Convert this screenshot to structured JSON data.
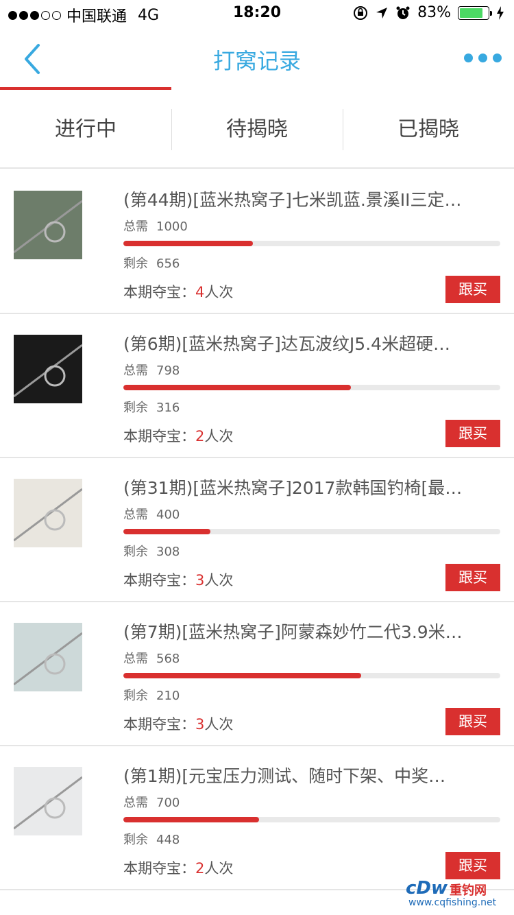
{
  "status_bar": {
    "carrier": "中国联通",
    "network": "4G",
    "time": "18:20",
    "battery": "83%",
    "battery_level": 0.83
  },
  "nav": {
    "title": "打窝记录"
  },
  "tabs": [
    {
      "label": "进行中"
    },
    {
      "label": "待揭晓"
    },
    {
      "label": "已揭晓"
    }
  ],
  "labels": {
    "need": "总需",
    "remain": "剩余",
    "join_prefix": "本期夺宝：",
    "join_suffix": "人次",
    "buy": "跟买"
  },
  "items": [
    {
      "title": "(第44期)[蓝米热窝子]七米凯蓝.景溪II三定…",
      "need": "1000",
      "remain": "656",
      "count": "4",
      "progress": 0.344,
      "thumb_color": "#6d7d6a"
    },
    {
      "title": "(第6期)[蓝米热窝子]达瓦波纹J5.4米超硬…",
      "need": "798",
      "remain": "316",
      "count": "2",
      "progress": 0.604,
      "thumb_color": "#1a1a1a"
    },
    {
      "title": "(第31期)[蓝米热窝子]2017款韩国钓椅[最…",
      "need": "400",
      "remain": "308",
      "count": "3",
      "progress": 0.23,
      "thumb_color": "#e9e6df"
    },
    {
      "title": "(第7期)[蓝米热窝子]阿蒙森妙竹二代3.9米…",
      "need": "568",
      "remain": "210",
      "count": "3",
      "progress": 0.63,
      "thumb_color": "#cdd9d9"
    },
    {
      "title": "(第1期)[元宝压力测试、随时下架、中奖…",
      "need": "700",
      "remain": "448",
      "count": "2",
      "progress": 0.36,
      "thumb_color": "#e9eaeb"
    }
  ],
  "watermark": {
    "logo": "cDw",
    "name": "重钓网",
    "url": "www.cqfishing.net"
  }
}
